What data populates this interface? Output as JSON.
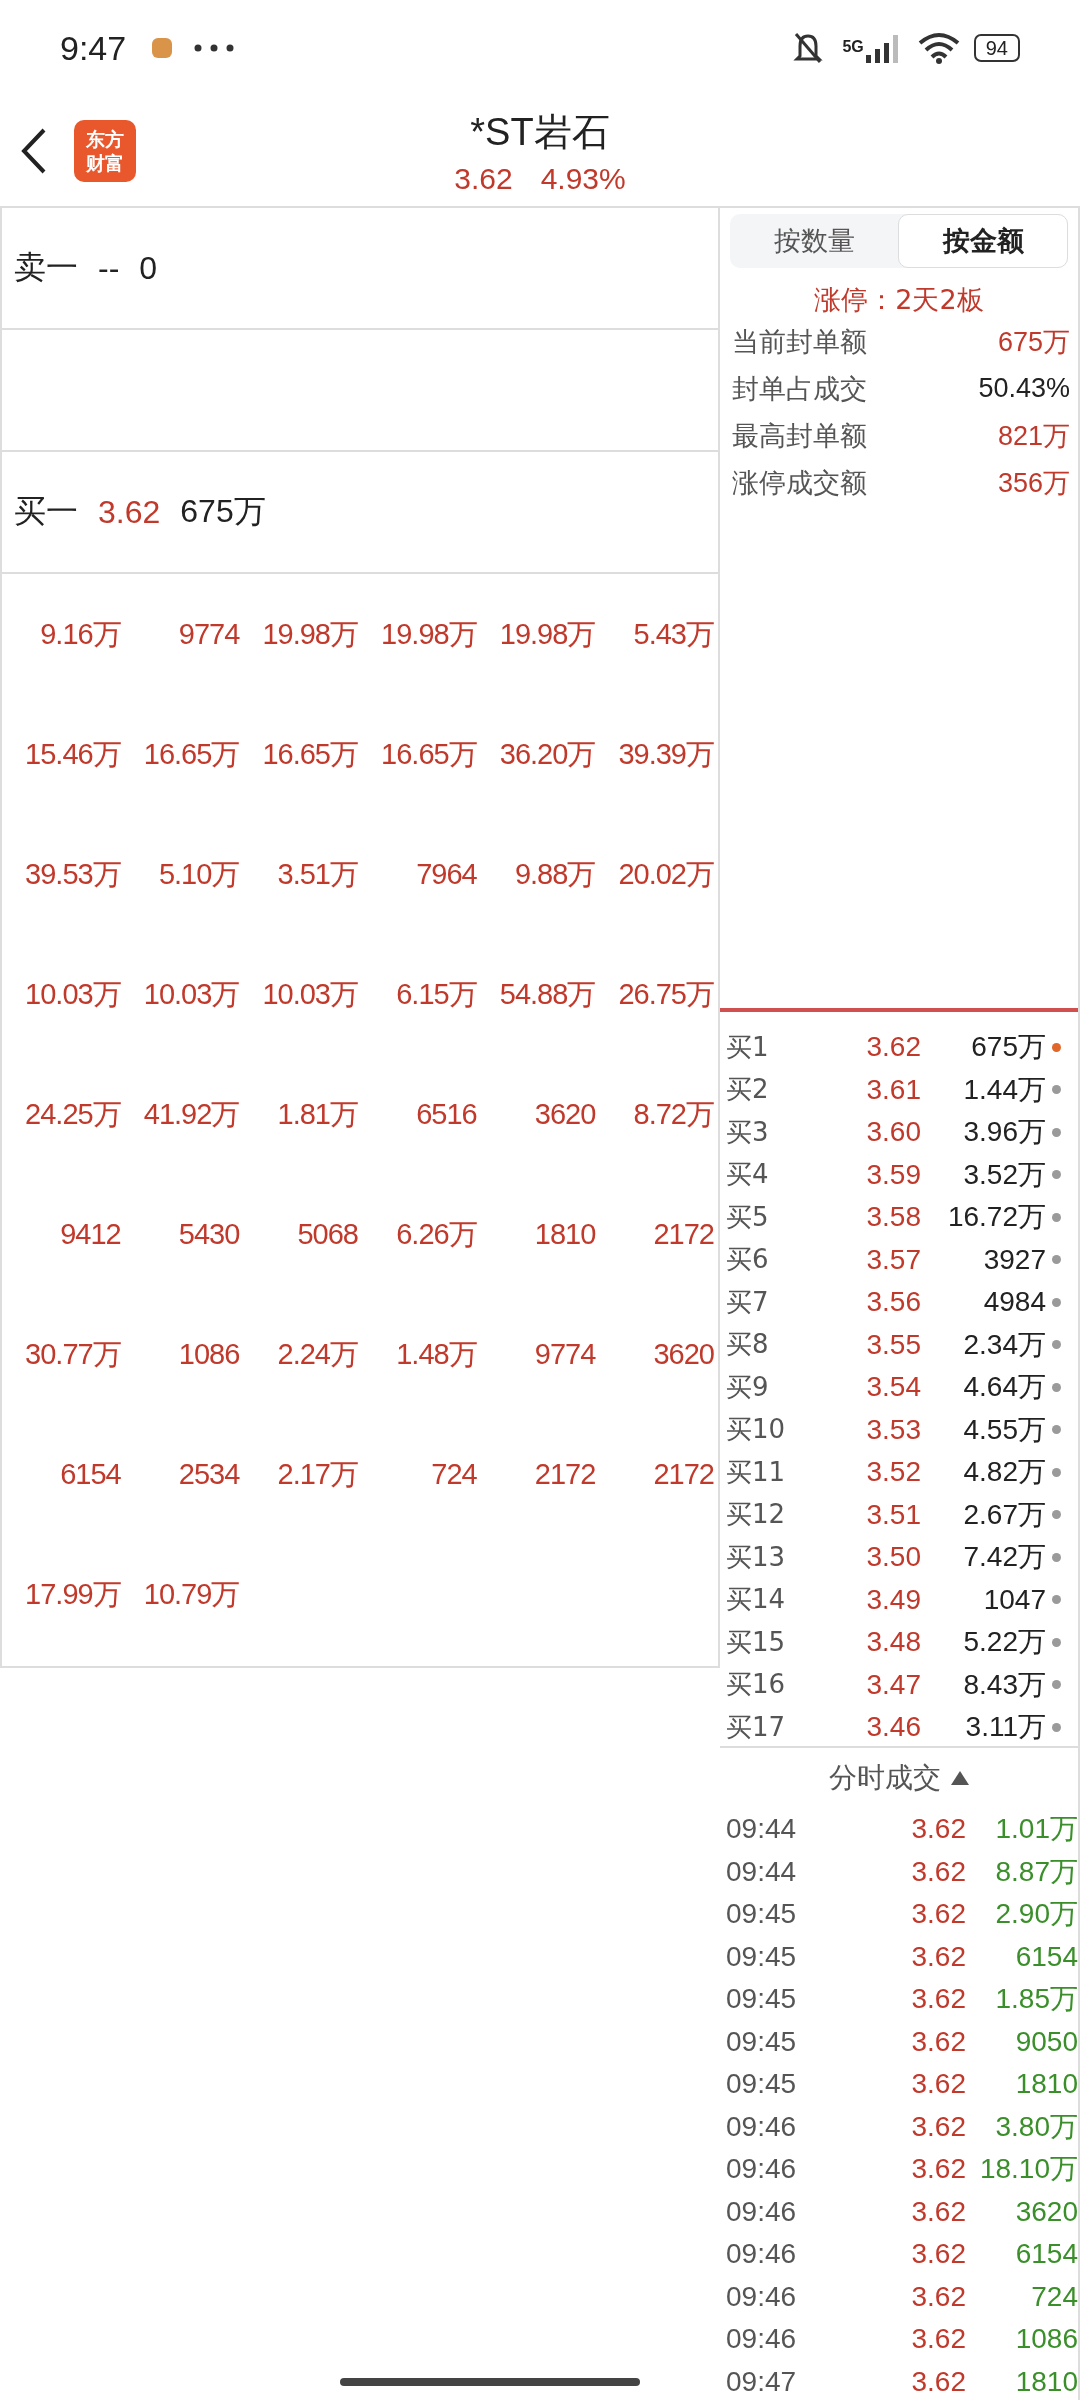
{
  "status_bar": {
    "time": "9:47",
    "battery": "94",
    "network": "5G"
  },
  "header": {
    "logo_text": [
      "东方",
      "财富"
    ],
    "title": "*ST岩石",
    "price": "3.62",
    "change": "4.93%"
  },
  "ask": {
    "label": "卖一",
    "price": "--",
    "amount": "0"
  },
  "bid": {
    "label": "买一",
    "price": "3.62",
    "amount": "675万"
  },
  "trade_grid": [
    [
      "9.16万",
      "9774",
      "19.98万",
      "19.98万",
      "19.98万",
      "5.43万"
    ],
    [
      "15.46万",
      "16.65万",
      "16.65万",
      "16.65万",
      "36.20万",
      "39.39万"
    ],
    [
      "39.53万",
      "5.10万",
      "3.51万",
      "7964",
      "9.88万",
      "20.02万"
    ],
    [
      "10.03万",
      "10.03万",
      "10.03万",
      "6.15万",
      "54.88万",
      "26.75万"
    ],
    [
      "24.25万",
      "41.92万",
      "1.81万",
      "6516",
      "3620",
      "8.72万"
    ],
    [
      "9412",
      "5430",
      "5068",
      "6.26万",
      "1810",
      "2172"
    ],
    [
      "30.77万",
      "1086",
      "2.24万",
      "1.48万",
      "9774",
      "3620"
    ],
    [
      "6154",
      "2534",
      "2.17万",
      "724",
      "2172",
      "2172"
    ],
    [
      "17.99万",
      "10.79万"
    ]
  ],
  "tabs": [
    {
      "label": "按数量",
      "selected": false
    },
    {
      "label": "按金额",
      "selected": true
    }
  ],
  "limit_up": "涨停：2天2板",
  "stats": [
    {
      "label": "当前封单额",
      "value": "675万",
      "color": "#c0392b"
    },
    {
      "label": "封单占成交",
      "value": "50.43%",
      "color": "#222222"
    },
    {
      "label": "最高封单额",
      "value": "821万",
      "color": "#c0392b"
    },
    {
      "label": "涨停成交额",
      "value": "356万",
      "color": "#c0392b"
    }
  ],
  "bid_queue": [
    {
      "level": "买1",
      "price": "3.62",
      "amount": "675万",
      "color": "#e0662a"
    },
    {
      "level": "买2",
      "price": "3.61",
      "amount": "1.44万",
      "color": "#9a9a9a"
    },
    {
      "level": "买3",
      "price": "3.60",
      "amount": "3.96万",
      "color": "#9a9a9a"
    },
    {
      "level": "买4",
      "price": "3.59",
      "amount": "3.52万",
      "color": "#9a9a9a"
    },
    {
      "level": "买5",
      "price": "3.58",
      "amount": "16.72万",
      "color": "#9a9a9a"
    },
    {
      "level": "买6",
      "price": "3.57",
      "amount": "3927",
      "color": "#9a9a9a"
    },
    {
      "level": "买7",
      "price": "3.56",
      "amount": "4984",
      "color": "#9a9a9a"
    },
    {
      "level": "买8",
      "price": "3.55",
      "amount": "2.34万",
      "color": "#9a9a9a"
    },
    {
      "level": "买9",
      "price": "3.54",
      "amount": "4.64万",
      "color": "#9a9a9a"
    },
    {
      "level": "买10",
      "price": "3.53",
      "amount": "4.55万",
      "color": "#9a9a9a"
    },
    {
      "level": "买11",
      "price": "3.52",
      "amount": "4.82万",
      "color": "#9a9a9a"
    },
    {
      "level": "买12",
      "price": "3.51",
      "amount": "2.67万",
      "color": "#9a9a9a"
    },
    {
      "level": "买13",
      "price": "3.50",
      "amount": "7.42万",
      "color": "#9a9a9a"
    },
    {
      "level": "买14",
      "price": "3.49",
      "amount": "1047",
      "color": "#9a9a9a"
    },
    {
      "level": "买15",
      "price": "3.48",
      "amount": "5.22万",
      "color": "#9a9a9a"
    },
    {
      "level": "买16",
      "price": "3.47",
      "amount": "8.43万",
      "color": "#9a9a9a"
    },
    {
      "level": "买17",
      "price": "3.46",
      "amount": "3.11万",
      "color": "#9a9a9a"
    }
  ],
  "ticks_header": "分时成交",
  "ticks": [
    {
      "time": "09:44",
      "price": "3.62",
      "amount": "1.01万"
    },
    {
      "time": "09:44",
      "price": "3.62",
      "amount": "8.87万"
    },
    {
      "time": "09:45",
      "price": "3.62",
      "amount": "2.90万"
    },
    {
      "time": "09:45",
      "price": "3.62",
      "amount": "6154"
    },
    {
      "time": "09:45",
      "price": "3.62",
      "amount": "1.85万"
    },
    {
      "time": "09:45",
      "price": "3.62",
      "amount": "9050"
    },
    {
      "time": "09:45",
      "price": "3.62",
      "amount": "1810"
    },
    {
      "time": "09:46",
      "price": "3.62",
      "amount": "3.80万"
    },
    {
      "time": "09:46",
      "price": "3.62",
      "amount": "18.10万"
    },
    {
      "time": "09:46",
      "price": "3.62",
      "amount": "3620"
    },
    {
      "time": "09:46",
      "price": "3.62",
      "amount": "6154"
    },
    {
      "time": "09:46",
      "price": "3.62",
      "amount": "724"
    },
    {
      "time": "09:46",
      "price": "3.62",
      "amount": "1086"
    },
    {
      "time": "09:47",
      "price": "3.62",
      "amount": "1810"
    }
  ]
}
